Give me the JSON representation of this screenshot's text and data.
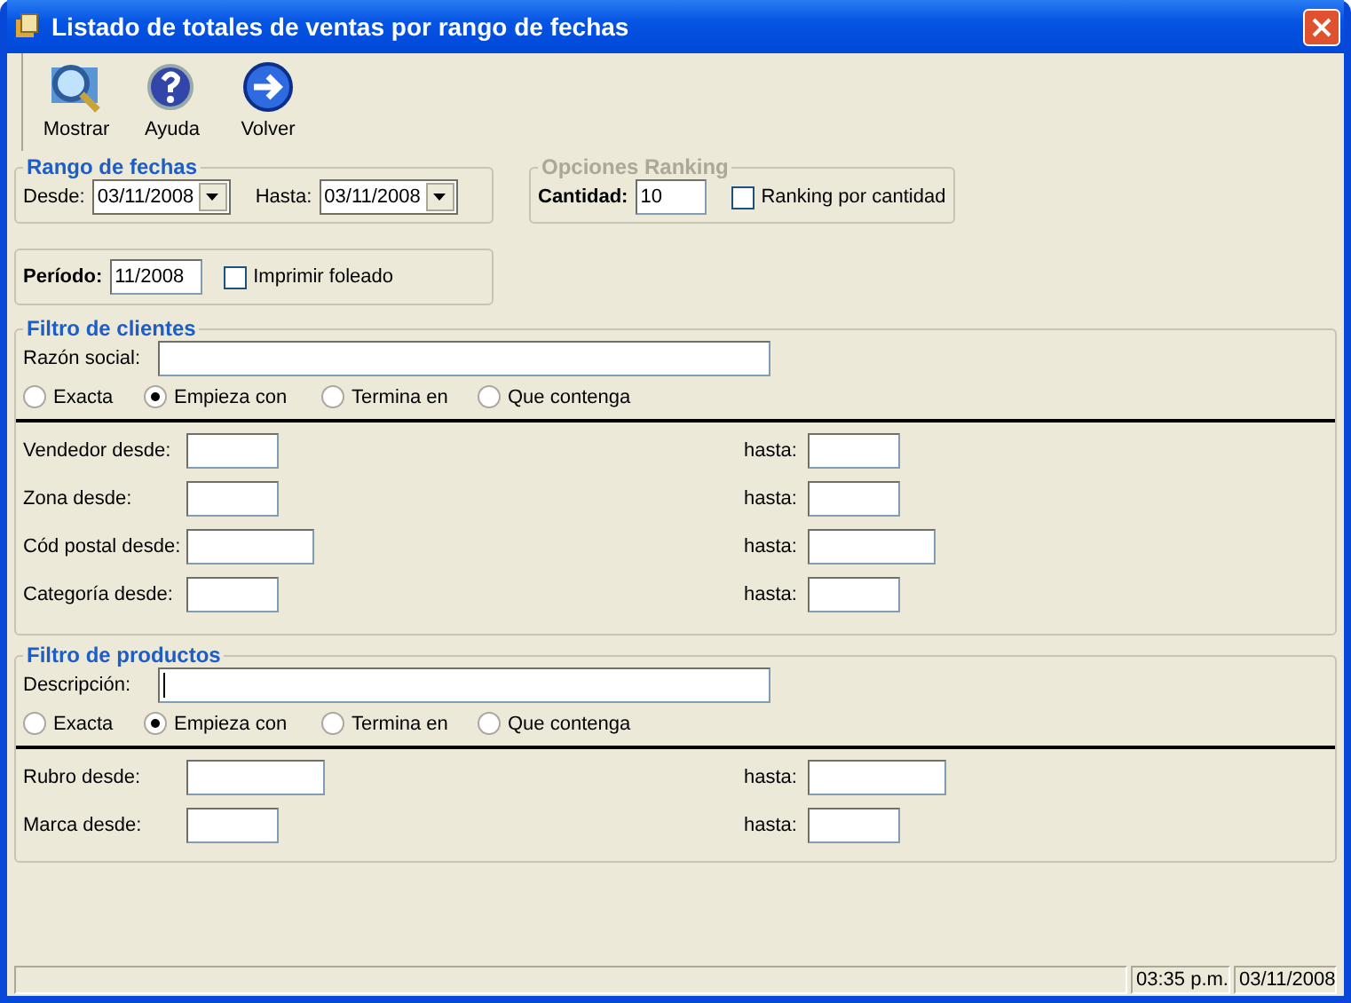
{
  "window": {
    "title": "Listado de totales de ventas por rango de fechas"
  },
  "toolbar": [
    {
      "label": "Mostrar",
      "kind": "search"
    },
    {
      "label": "Ayuda",
      "kind": "help"
    },
    {
      "label": "Volver",
      "kind": "back"
    }
  ],
  "date_range": {
    "title": "Rango de fechas",
    "from_label": "Desde:",
    "from_value": "03/11/2008",
    "to_label": "Hasta:",
    "to_value": "03/11/2008"
  },
  "ranking": {
    "title": "Opciones Ranking",
    "disabled": true,
    "quantity_label": "Cantidad:",
    "quantity_value": "10",
    "checkbox": {
      "label": "Ranking por cantidad",
      "checked": false
    }
  },
  "period": {
    "label": "Período:",
    "value": "11/2008",
    "checkbox": {
      "label": "Imprimir foleado",
      "checked": false
    }
  },
  "filters": [
    {
      "title": "Filtro de clientes",
      "text_label": "Razón social:",
      "focused": false,
      "radios": [
        {
          "label": "Exacta",
          "selected": false
        },
        {
          "label": "Empieza con",
          "selected": true
        },
        {
          "label": "Termina en",
          "selected": false
        },
        {
          "label": "Que contenga",
          "selected": false
        }
      ],
      "ranges": [
        {
          "from_label": "Vendedor desde:",
          "to_label": "hasta:",
          "kind": "narrow"
        },
        {
          "from_label": "Zona desde:",
          "to_label": "hasta:",
          "kind": "narrow"
        },
        {
          "from_label": "Cód postal desde:",
          "to_label": "hasta:",
          "kind": "wide"
        },
        {
          "from_label": "Categoría desde:",
          "to_label": "hasta:",
          "kind": "narrow"
        }
      ]
    },
    {
      "title": "Filtro de productos",
      "text_label": "Descripción:",
      "focused": true,
      "radios": [
        {
          "label": "Exacta",
          "selected": false
        },
        {
          "label": "Empieza con",
          "selected": true
        },
        {
          "label": "Termina en",
          "selected": false
        },
        {
          "label": "Que contenga",
          "selected": false
        }
      ],
      "ranges": [
        {
          "from_label": "Rubro desde:",
          "to_label": "hasta:",
          "kind": "wide"
        },
        {
          "from_label": "Marca desde:",
          "to_label": "hasta:",
          "kind": "narrow"
        }
      ]
    }
  ],
  "status_bar": [
    "03:35 p.m.",
    "03/11/2008"
  ]
}
